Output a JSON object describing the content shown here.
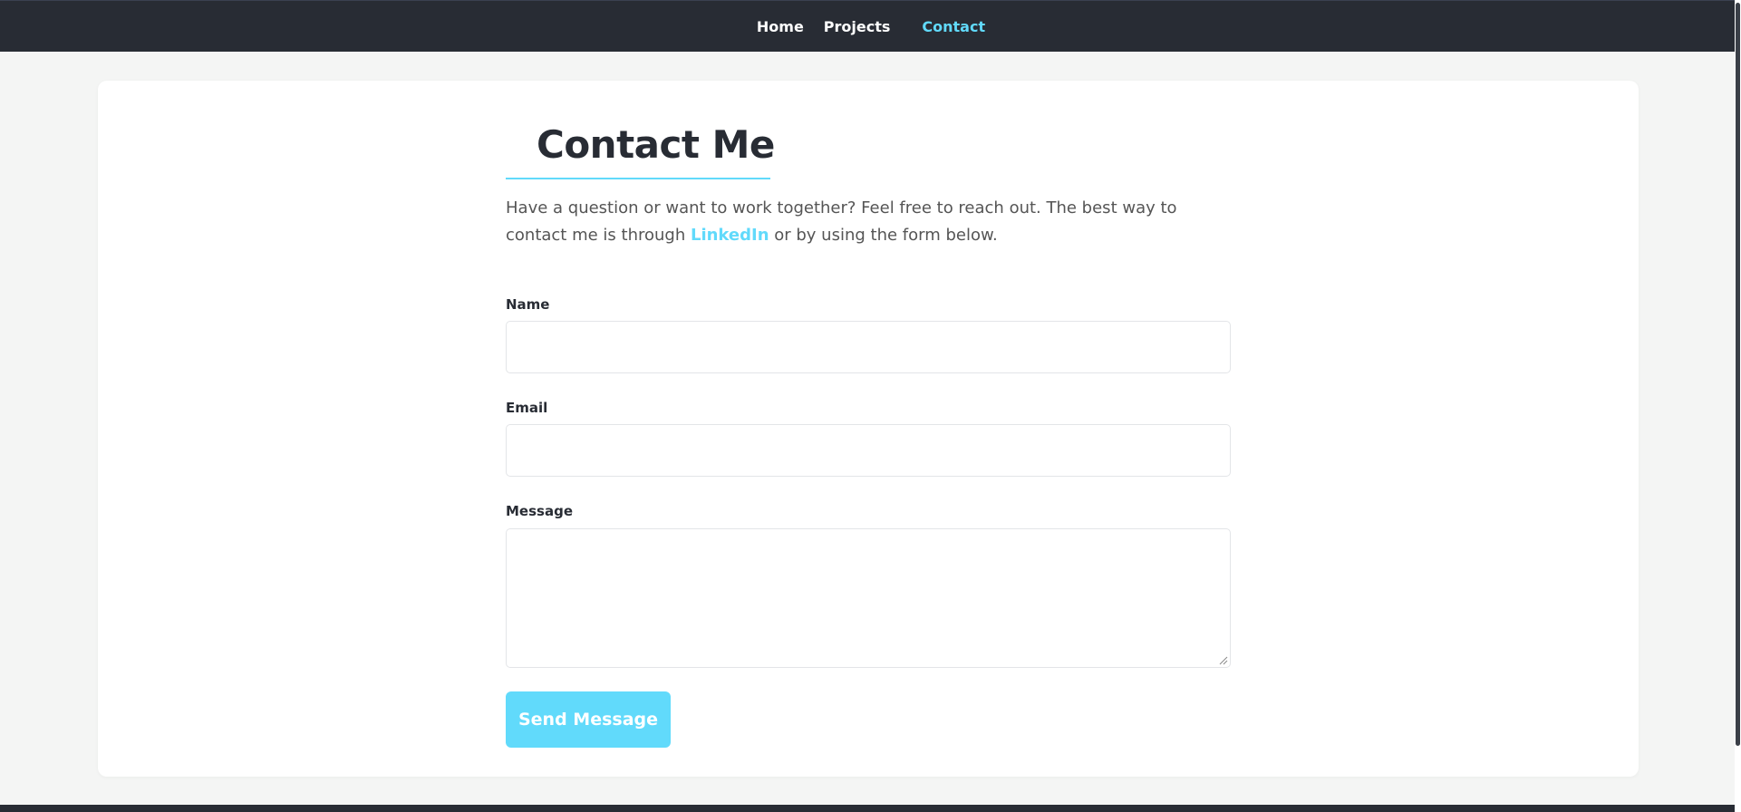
{
  "nav": {
    "links": [
      {
        "label": "Home",
        "active": false
      },
      {
        "label": "Projects",
        "active": false
      },
      {
        "label": "Contact",
        "active": true
      }
    ]
  },
  "page": {
    "icon": "envelope-icon",
    "title": "Contact Me",
    "intro_before": "Have a question or want to work together? Feel free to reach out. The best way to contact me is through ",
    "intro_link": "LinkedIn",
    "intro_after": " or by using the form below."
  },
  "form": {
    "name_label": "Name",
    "name_value": "",
    "email_label": "Email",
    "email_value": "",
    "message_label": "Message",
    "message_value": "",
    "submit_label": "Send Message"
  },
  "colors": {
    "accent": "#61dafb",
    "navbar": "#282c34",
    "background": "#f4f5f4",
    "text_dark": "#282c34",
    "text_body": "#555555"
  }
}
